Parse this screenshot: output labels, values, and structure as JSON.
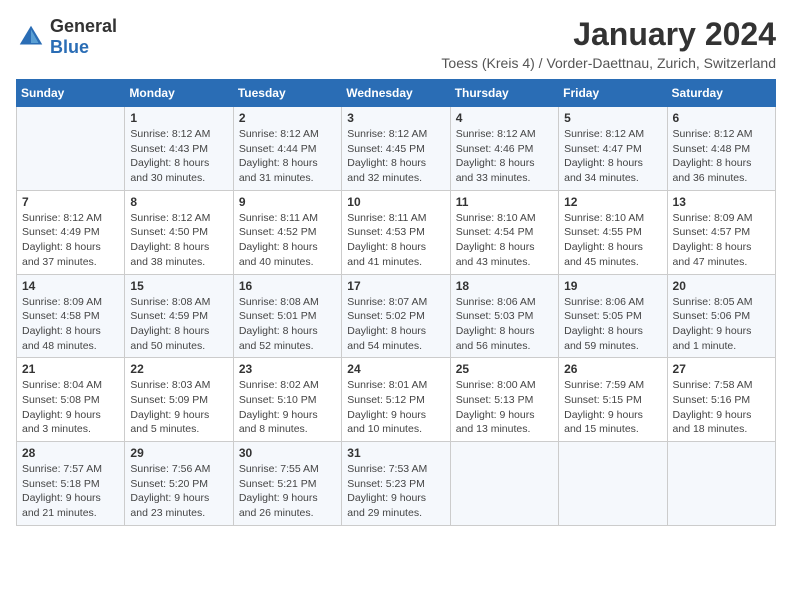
{
  "logo": {
    "general": "General",
    "blue": "Blue"
  },
  "title": "January 2024",
  "subtitle": "Toess (Kreis 4) / Vorder-Daettnau, Zurich, Switzerland",
  "days_of_week": [
    "Sunday",
    "Monday",
    "Tuesday",
    "Wednesday",
    "Thursday",
    "Friday",
    "Saturday"
  ],
  "weeks": [
    [
      {
        "day": "",
        "info": ""
      },
      {
        "day": "1",
        "info": "Sunrise: 8:12 AM\nSunset: 4:43 PM\nDaylight: 8 hours\nand 30 minutes."
      },
      {
        "day": "2",
        "info": "Sunrise: 8:12 AM\nSunset: 4:44 PM\nDaylight: 8 hours\nand 31 minutes."
      },
      {
        "day": "3",
        "info": "Sunrise: 8:12 AM\nSunset: 4:45 PM\nDaylight: 8 hours\nand 32 minutes."
      },
      {
        "day": "4",
        "info": "Sunrise: 8:12 AM\nSunset: 4:46 PM\nDaylight: 8 hours\nand 33 minutes."
      },
      {
        "day": "5",
        "info": "Sunrise: 8:12 AM\nSunset: 4:47 PM\nDaylight: 8 hours\nand 34 minutes."
      },
      {
        "day": "6",
        "info": "Sunrise: 8:12 AM\nSunset: 4:48 PM\nDaylight: 8 hours\nand 36 minutes."
      }
    ],
    [
      {
        "day": "7",
        "info": "Sunrise: 8:12 AM\nSunset: 4:49 PM\nDaylight: 8 hours\nand 37 minutes."
      },
      {
        "day": "8",
        "info": "Sunrise: 8:12 AM\nSunset: 4:50 PM\nDaylight: 8 hours\nand 38 minutes."
      },
      {
        "day": "9",
        "info": "Sunrise: 8:11 AM\nSunset: 4:52 PM\nDaylight: 8 hours\nand 40 minutes."
      },
      {
        "day": "10",
        "info": "Sunrise: 8:11 AM\nSunset: 4:53 PM\nDaylight: 8 hours\nand 41 minutes."
      },
      {
        "day": "11",
        "info": "Sunrise: 8:10 AM\nSunset: 4:54 PM\nDaylight: 8 hours\nand 43 minutes."
      },
      {
        "day": "12",
        "info": "Sunrise: 8:10 AM\nSunset: 4:55 PM\nDaylight: 8 hours\nand 45 minutes."
      },
      {
        "day": "13",
        "info": "Sunrise: 8:09 AM\nSunset: 4:57 PM\nDaylight: 8 hours\nand 47 minutes."
      }
    ],
    [
      {
        "day": "14",
        "info": "Sunrise: 8:09 AM\nSunset: 4:58 PM\nDaylight: 8 hours\nand 48 minutes."
      },
      {
        "day": "15",
        "info": "Sunrise: 8:08 AM\nSunset: 4:59 PM\nDaylight: 8 hours\nand 50 minutes."
      },
      {
        "day": "16",
        "info": "Sunrise: 8:08 AM\nSunset: 5:01 PM\nDaylight: 8 hours\nand 52 minutes."
      },
      {
        "day": "17",
        "info": "Sunrise: 8:07 AM\nSunset: 5:02 PM\nDaylight: 8 hours\nand 54 minutes."
      },
      {
        "day": "18",
        "info": "Sunrise: 8:06 AM\nSunset: 5:03 PM\nDaylight: 8 hours\nand 56 minutes."
      },
      {
        "day": "19",
        "info": "Sunrise: 8:06 AM\nSunset: 5:05 PM\nDaylight: 8 hours\nand 59 minutes."
      },
      {
        "day": "20",
        "info": "Sunrise: 8:05 AM\nSunset: 5:06 PM\nDaylight: 9 hours\nand 1 minute."
      }
    ],
    [
      {
        "day": "21",
        "info": "Sunrise: 8:04 AM\nSunset: 5:08 PM\nDaylight: 9 hours\nand 3 minutes."
      },
      {
        "day": "22",
        "info": "Sunrise: 8:03 AM\nSunset: 5:09 PM\nDaylight: 9 hours\nand 5 minutes."
      },
      {
        "day": "23",
        "info": "Sunrise: 8:02 AM\nSunset: 5:10 PM\nDaylight: 9 hours\nand 8 minutes."
      },
      {
        "day": "24",
        "info": "Sunrise: 8:01 AM\nSunset: 5:12 PM\nDaylight: 9 hours\nand 10 minutes."
      },
      {
        "day": "25",
        "info": "Sunrise: 8:00 AM\nSunset: 5:13 PM\nDaylight: 9 hours\nand 13 minutes."
      },
      {
        "day": "26",
        "info": "Sunrise: 7:59 AM\nSunset: 5:15 PM\nDaylight: 9 hours\nand 15 minutes."
      },
      {
        "day": "27",
        "info": "Sunrise: 7:58 AM\nSunset: 5:16 PM\nDaylight: 9 hours\nand 18 minutes."
      }
    ],
    [
      {
        "day": "28",
        "info": "Sunrise: 7:57 AM\nSunset: 5:18 PM\nDaylight: 9 hours\nand 21 minutes."
      },
      {
        "day": "29",
        "info": "Sunrise: 7:56 AM\nSunset: 5:20 PM\nDaylight: 9 hours\nand 23 minutes."
      },
      {
        "day": "30",
        "info": "Sunrise: 7:55 AM\nSunset: 5:21 PM\nDaylight: 9 hours\nand 26 minutes."
      },
      {
        "day": "31",
        "info": "Sunrise: 7:53 AM\nSunset: 5:23 PM\nDaylight: 9 hours\nand 29 minutes."
      },
      {
        "day": "",
        "info": ""
      },
      {
        "day": "",
        "info": ""
      },
      {
        "day": "",
        "info": ""
      }
    ]
  ]
}
